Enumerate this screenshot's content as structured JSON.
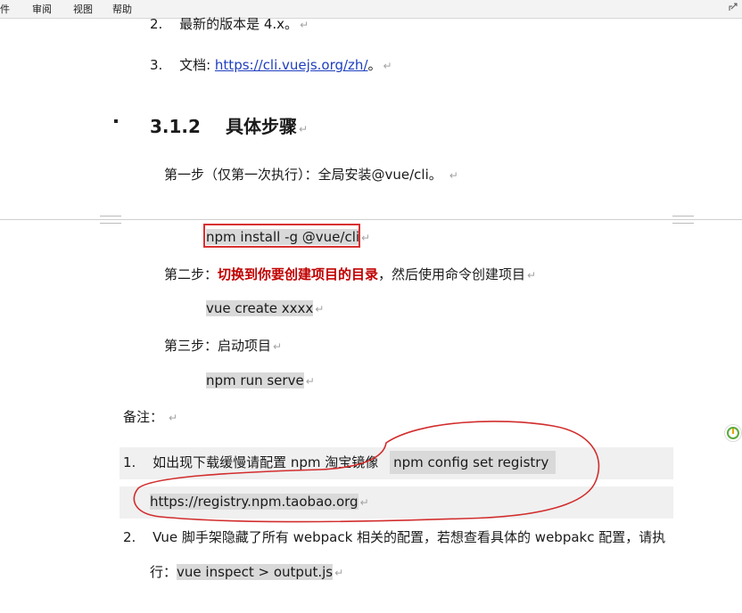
{
  "menubar": {
    "items": [
      "件",
      "审阅",
      "视图",
      "帮助"
    ]
  },
  "list_top": {
    "item2_num": "2.",
    "item2_text": "最新的版本是 4.x。",
    "item3_num": "3.",
    "item3_prefix": "文档: ",
    "item3_link": "https://cli.vuejs.org/zh/",
    "item3_suffix": "。"
  },
  "section": {
    "number": "3.1.2",
    "title": "具体步骤"
  },
  "steps": {
    "step1": "第一步（仅第一次执行）：全局安装@vue/cli。",
    "cmd1": "npm install -g @vue/cli",
    "step2_prefix": "第二步：",
    "step2_bold": "切换到你要创建项目的目录",
    "step2_suffix": "，然后使用命令创建项目",
    "cmd2": "vue create xxxx",
    "step3": "第三步：启动项目",
    "cmd3": "npm run serve"
  },
  "notes": {
    "label": "备注：",
    "n1_num": "1.",
    "n1_text": "如出现下载缓慢请配置 npm 淘宝镜像",
    "n1_cmd": "npm config set registry",
    "n1_url": "https://registry.npm.taobao.org",
    "n2_num": "2.",
    "n2_text": "Vue 脚手架隐藏了所有 webpack 相关的配置，若想查看具体的 webpakc 配置，请执",
    "n2_line2_prefix": "行：",
    "n2_cmd": "vue inspect > output.js"
  },
  "marks": {
    "para": "↵"
  },
  "colors": {
    "link": "#1f3fbf",
    "emphasis": "#c00000",
    "annotation": "#d83030",
    "code_bg": "#d9d9d9"
  }
}
